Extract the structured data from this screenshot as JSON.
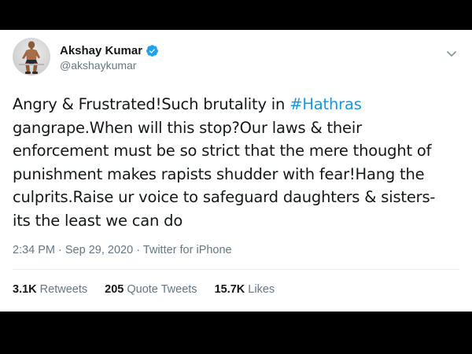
{
  "tweet": {
    "author": {
      "name": "Akshay Kumar",
      "handle": "@akshaykumar",
      "verified": true
    },
    "text_before_hashtag": "Angry & Frustrated!Such brutality in ",
    "hashtag": "#Hathras",
    "text_after_hashtag": "\ngangrape.When will this stop?Our laws & their\nenforcement must be so strict that the mere thought of\npunishment makes rapists shudder with fear!Hang the\nculprits.Raise ur voice to safeguard daughters & sisters-\nits the least we can do",
    "time": "2:34 PM",
    "date": "Sep 29, 2020",
    "source": "Twitter for iPhone",
    "separator": " · ",
    "stats": {
      "retweets_count": "3.1K",
      "retweets_label": "Retweets",
      "quote_count": "205",
      "quote_label": "Quote Tweets",
      "likes_count": "15.7K",
      "likes_label": "Likes"
    }
  },
  "colors": {
    "link": "#1b95e0",
    "verified": "#1da1f2",
    "secondary_text": "#657786",
    "primary_text": "#14171a"
  },
  "icons": {
    "verified": "verified-badge-icon",
    "more": "chevron-down-icon"
  }
}
